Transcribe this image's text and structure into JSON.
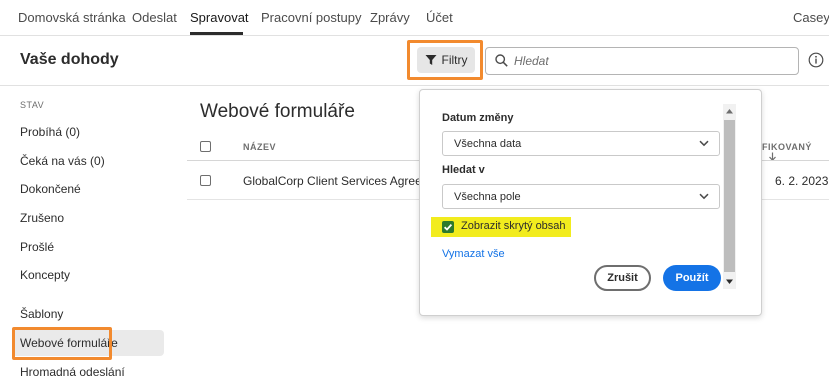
{
  "colors": {
    "accent_blue": "#1473e6",
    "highlight_orange": "#f28a2e",
    "highlight_yellow": "#f2ec1e",
    "checkbox_green": "#2d7a2d"
  },
  "nav": {
    "tabs": [
      "Domovská stránka",
      "Odeslat",
      "Spravovat",
      "Pracovní postupy",
      "Zprávy",
      "Účet"
    ],
    "active_tab": "Spravovat",
    "user": "Casey"
  },
  "header": {
    "title": "Vaše dohody",
    "filters_label": "Filtry",
    "search_placeholder": "Hledat"
  },
  "sidebar": {
    "heading": "STAV",
    "items": [
      {
        "label": "Probíhá (0)"
      },
      {
        "label": "Čeká na vás (0)"
      },
      {
        "label": "Dokončené"
      },
      {
        "label": "Zrušeno"
      },
      {
        "label": "Prošlé"
      },
      {
        "label": "Koncepty"
      },
      {
        "label": "Šablony"
      },
      {
        "label": "Webové formuláře"
      },
      {
        "label": "Hromadná odeslání"
      }
    ],
    "active_item": "Webové formuláře"
  },
  "main": {
    "title": "Webové formuláře",
    "columns": {
      "name": "NÁZEV",
      "modified": "FIKOVANÝ",
      "sort_icon": "arrow-down-icon"
    },
    "rows": [
      {
        "name": "GlobalCorp Client Services Agreement",
        "modified": "6. 2. 2023"
      }
    ]
  },
  "filter_popover": {
    "date_label": "Datum změny",
    "date_value": "Všechna data",
    "search_in_label": "Hledat v",
    "search_in_value": "Všechna pole",
    "show_hidden_label": "Zobrazit skrytý obsah",
    "show_hidden_checked": true,
    "clear_all": "Vymazat vše",
    "cancel": "Zrušit",
    "apply": "Použít"
  }
}
